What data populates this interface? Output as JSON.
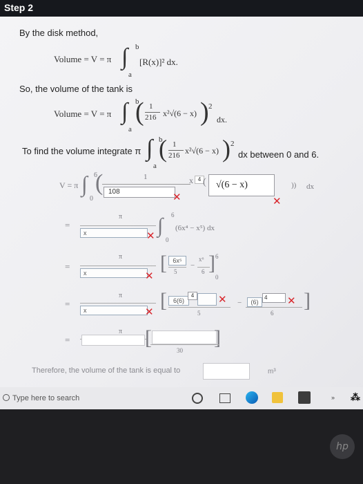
{
  "header": {
    "title": "Step 2"
  },
  "intro": {
    "text": "By the disk method,"
  },
  "eq1": {
    "lhs": "Volume = V = π",
    "integrand": "[R(x)]² dx.",
    "upper": "b",
    "lower": "a"
  },
  "so_text": "So, the volume of the tank is",
  "eq2": {
    "lhs": "Volume = V = π",
    "frac_num": "1",
    "frac_den": "216",
    "rest": "x²√(6 − x)",
    "pow": "2",
    "dx": "dx.",
    "upper": "b",
    "lower": "a"
  },
  "find_text": {
    "prefix": "To find the volume integrate π",
    "suffix": "dx between 0 and 6.",
    "frac_num": "1",
    "frac_den": "216",
    "rest": "x²√(6 − x)",
    "pow": "2",
    "upper": "b",
    "lower": "a"
  },
  "line1": {
    "lhs": "V = π",
    "upper": "6",
    "lower": "0",
    "num": "1",
    "box1": "108",
    "box2": "4",
    "box3": "√(6 − x)",
    "tail": "))",
    "dx": "dx"
  },
  "line2": {
    "num": "π",
    "box": "x",
    "integral": "(6x⁴ − x⁵) dx",
    "upper": "6",
    "lower": "0"
  },
  "line3": {
    "num": "π",
    "box": "x",
    "frac1_num": "6x⁵",
    "frac1_den": "5",
    "frac2_num": "x⁶",
    "frac2_den": "6",
    "upper": "6",
    "lower": "0"
  },
  "line4": {
    "num": "π",
    "box": "x",
    "part1": "6(6)",
    "exp1": "4",
    "den1": "5",
    "part2": "(6)",
    "exp2": "4",
    "den2": "6"
  },
  "line5": {
    "num": "π",
    "val": "30"
  },
  "answer": {
    "text": "Therefore, the volume of the tank is equal to",
    "unit": "m³"
  },
  "taskbar": {
    "search_placeholder": "Type here to search"
  },
  "colors": {
    "wrong": "#d8262c",
    "header": "#16181d"
  },
  "brand": "hp"
}
